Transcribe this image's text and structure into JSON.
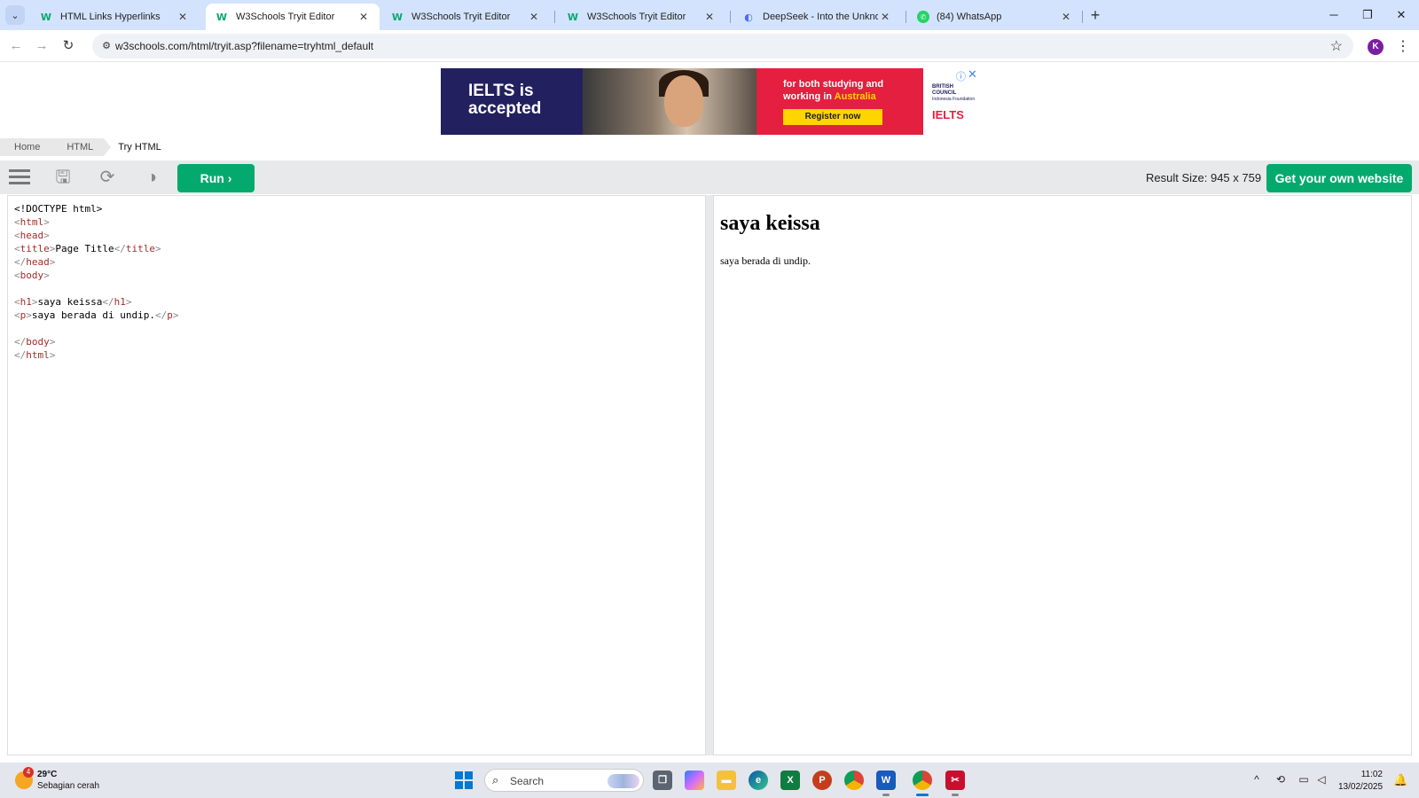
{
  "browser": {
    "tabs": [
      {
        "title": "HTML Links Hyperlinks",
        "favicon": "W"
      },
      {
        "title": "W3Schools Tryit Editor",
        "favicon": "W",
        "active": true
      },
      {
        "title": "W3Schools Tryit Editor",
        "favicon": "W"
      },
      {
        "title": "W3Schools Tryit Editor",
        "favicon": "W"
      },
      {
        "title": "DeepSeek - Into the Unknown",
        "favicon": "deepseek-icon"
      },
      {
        "title": "(84) WhatsApp",
        "favicon": "whatsapp-icon"
      }
    ],
    "url": "w3schools.com/html/tryit.asp?filename=tryhtml_default",
    "profile_initial": "K"
  },
  "ad": {
    "headline": "IELTS is accepted",
    "promo": "for both studying and working in",
    "promo_highlight": "Australia",
    "cta": "Register now",
    "brand_line1": "BRITISH",
    "brand_line2": "COUNCIL",
    "brand_line3": "Indonesia Foundation",
    "brand_logo": "IELTS"
  },
  "breadcrumb": [
    "Home",
    "HTML",
    "Try HTML"
  ],
  "editor_toolbar": {
    "run_label": "Run",
    "result_size": "Result Size: 945 x 759",
    "get_website_label": "Get your own website"
  },
  "code_lines": [
    "<!DOCTYPE html>",
    "<html>",
    "<head>",
    "<title>Page Title</title>",
    "</head>",
    "<body>",
    "",
    "<h1>saya keissa</h1>",
    "<p>saya berada di undip.</p>",
    "",
    "</body>",
    "</html>"
  ],
  "result": {
    "heading": "saya keissa",
    "paragraph": "saya berada di undip."
  },
  "taskbar": {
    "weather_temp": "29°C",
    "weather_desc": "Sebagian cerah",
    "weather_badge": "4",
    "search_placeholder": "Search",
    "time": "11:02",
    "date": "13/02/2025"
  },
  "colors": {
    "w3_green": "#04aa6d",
    "tabstrip": "#d3e3fd",
    "toolbar_gray": "#e7e9eb",
    "tag_color": "#a52a2a",
    "bracket_color": "#888888"
  }
}
